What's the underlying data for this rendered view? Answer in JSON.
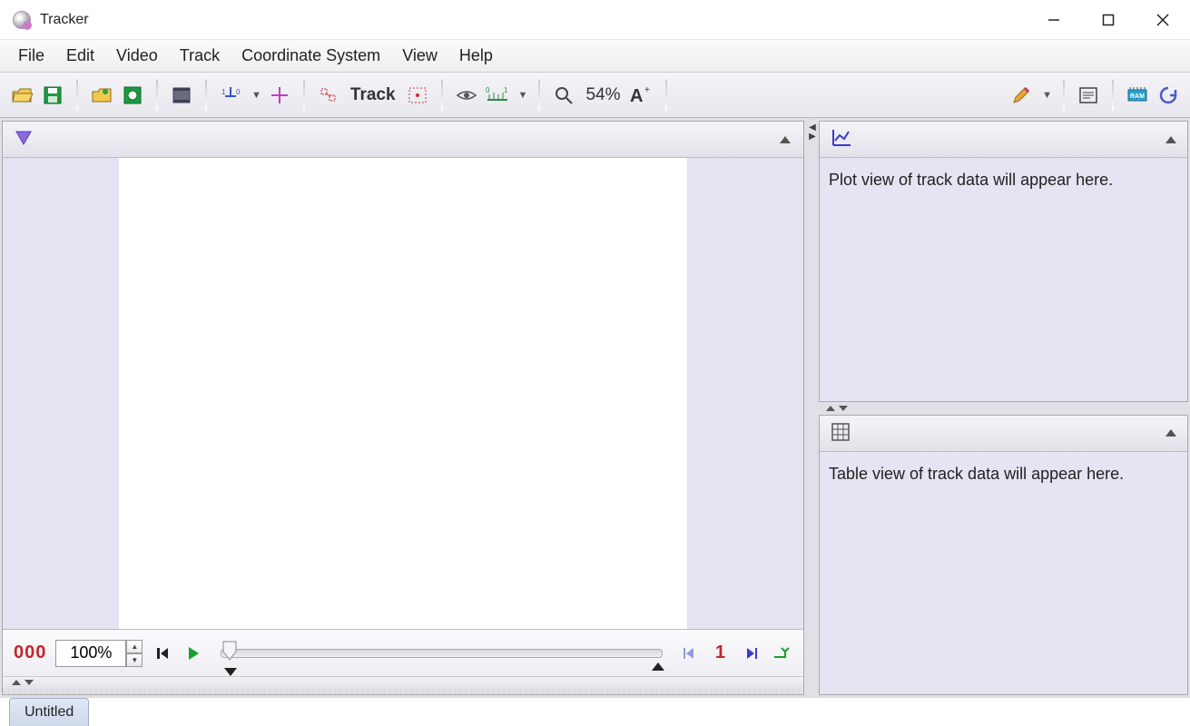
{
  "window": {
    "title": "Tracker"
  },
  "menus": {
    "file": "File",
    "edit": "Edit",
    "video": "Video",
    "track": "Track",
    "coord": "Coordinate System",
    "view": "View",
    "help": "Help"
  },
  "toolbar": {
    "track_label": "Track",
    "zoom_pct": "54%"
  },
  "playbar": {
    "frame": "000",
    "zoom": "100%",
    "step": "1"
  },
  "right": {
    "plot_hint": "Plot view of track data will appear here.",
    "table_hint": "Table view of track data will appear here."
  },
  "tabs": {
    "active": "Untitled"
  }
}
